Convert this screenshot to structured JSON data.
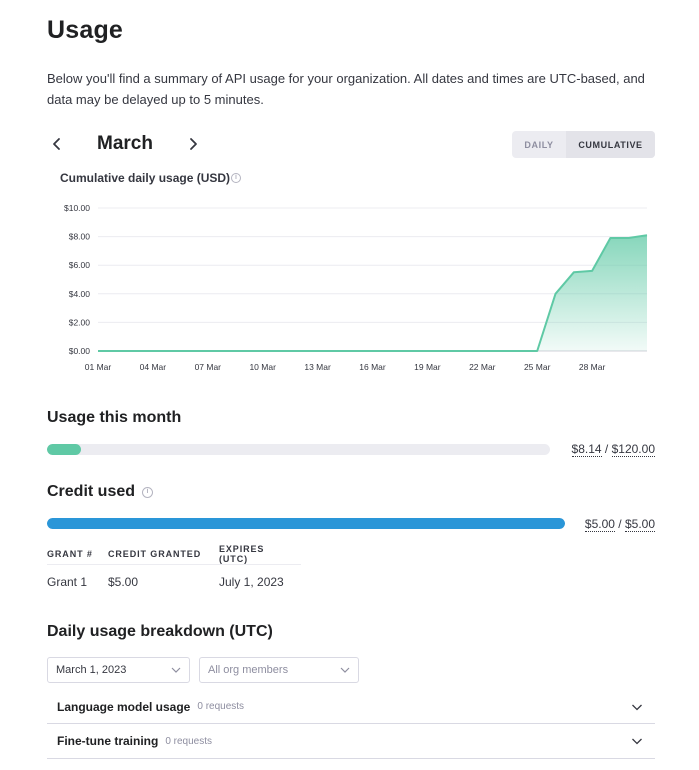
{
  "page": {
    "title": "Usage",
    "intro": "Below you'll find a summary of API usage for your organization. All dates and times are UTC-based, and data may be delayed up to 5 minutes."
  },
  "month_nav": {
    "label": "March"
  },
  "view_toggle": {
    "daily": "DAILY",
    "cumulative": "CUMULATIVE",
    "selected": "cumulative"
  },
  "chart_title": "Cumulative daily usage (USD)",
  "chart_data": {
    "type": "area",
    "title": "Cumulative daily usage (USD)",
    "xlabel": "",
    "ylabel": "",
    "ylim": [
      0,
      10
    ],
    "yticks": [
      "$0.00",
      "$2.00",
      "$4.00",
      "$6.00",
      "$8.00",
      "$10.00"
    ],
    "xticks": [
      "01 Mar",
      "04 Mar",
      "07 Mar",
      "10 Mar",
      "13 Mar",
      "16 Mar",
      "19 Mar",
      "22 Mar",
      "25 Mar",
      "28 Mar"
    ],
    "grid": true,
    "color": "#5fc9a5",
    "x": [
      1,
      2,
      3,
      4,
      5,
      6,
      7,
      8,
      9,
      10,
      11,
      12,
      13,
      14,
      15,
      16,
      17,
      18,
      19,
      20,
      21,
      22,
      23,
      24,
      25,
      26,
      27,
      28,
      29,
      30,
      31
    ],
    "y": [
      0,
      0,
      0,
      0,
      0,
      0,
      0,
      0,
      0,
      0,
      0,
      0,
      0,
      0,
      0,
      0,
      0,
      0,
      0,
      0,
      0,
      0,
      0,
      0,
      0,
      4.0,
      5.5,
      5.6,
      7.9,
      7.9,
      8.1
    ]
  },
  "usage_month": {
    "heading": "Usage this month",
    "used": "$8.14",
    "separator": "/",
    "limit": "$120.00",
    "fraction": 0.0678,
    "color": "#5fc9a5"
  },
  "credit": {
    "heading": "Credit used",
    "used": "$5.00",
    "separator": "/",
    "total": "$5.00",
    "fraction": 1.0,
    "color": "#2a96d8"
  },
  "grants_table": {
    "headers": [
      "GRANT #",
      "CREDIT GRANTED",
      "EXPIRES (UTC)"
    ],
    "rows": [
      [
        "Grant 1",
        "$5.00",
        "July 1, 2023"
      ]
    ]
  },
  "breakdown": {
    "heading": "Daily usage breakdown (UTC)",
    "date_select": "March 1, 2023",
    "member_select": "All org members",
    "sections": [
      {
        "title": "Language model usage",
        "count": "0 requests"
      },
      {
        "title": "Fine-tune training",
        "count": "0 requests"
      }
    ]
  }
}
